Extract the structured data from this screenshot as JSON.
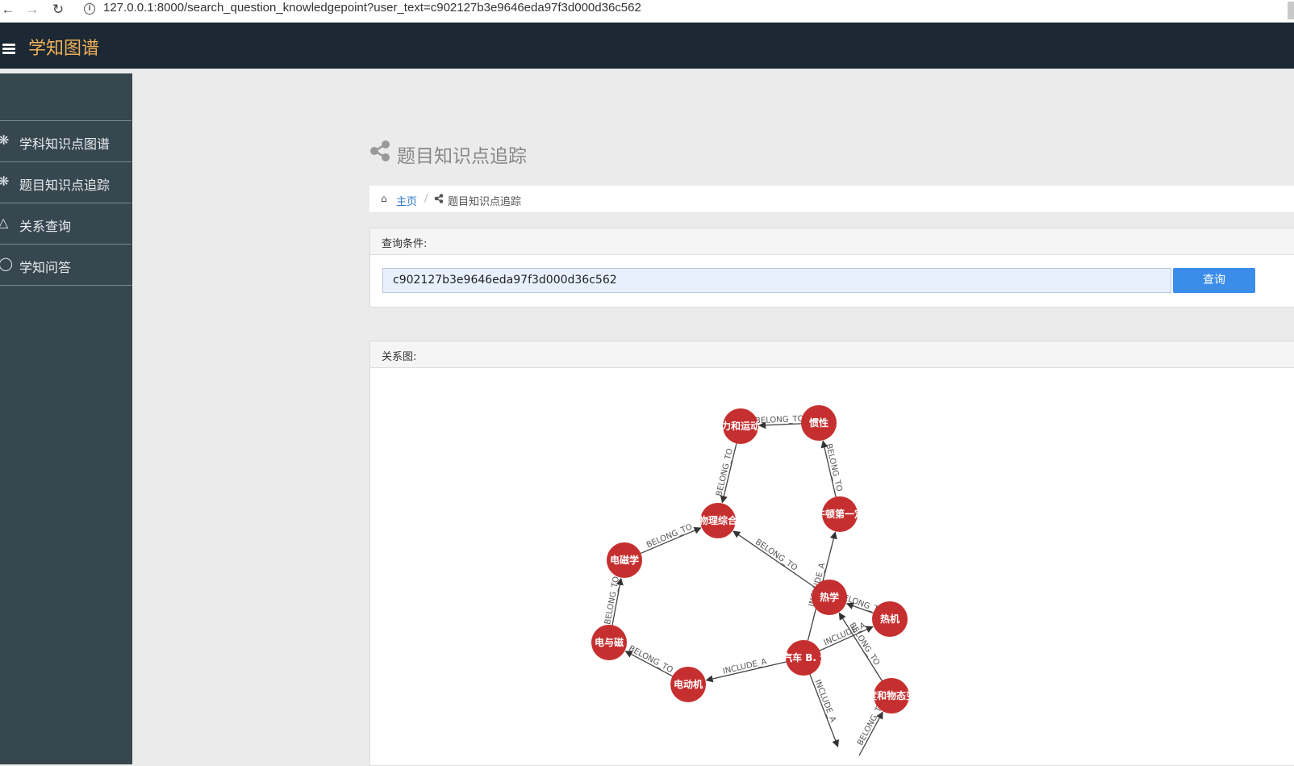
{
  "browser": {
    "url": "127.0.0.1:8000/search_question_knowledgepoint?user_text=c902127b3e9646eda97f3d000d36c562"
  },
  "app": {
    "brand": "学知图谱"
  },
  "sidebar": {
    "items": [
      {
        "label": "学科知识点图谱",
        "icon": "atom-icon"
      },
      {
        "label": "题目知识点追踪",
        "icon": "atom-icon"
      },
      {
        "label": "关系查询",
        "icon": "drive-icon"
      },
      {
        "label": "学知问答",
        "icon": "chat-icon"
      }
    ]
  },
  "page": {
    "title": "题目知识点追踪"
  },
  "breadcrumb": {
    "home": "主页",
    "separator": "/",
    "current": "题目知识点追踪"
  },
  "query": {
    "header": "查询条件:",
    "value": "c902127b3e9646eda97f3d000d36c562",
    "button": "查询"
  },
  "graph": {
    "header": "关系图:",
    "node_color": "#c62f2f",
    "nodes": [
      {
        "id": "n_force",
        "label": "力和运动"
      },
      {
        "id": "n_inertia",
        "label": "惯性"
      },
      {
        "id": "n_physics",
        "label": "物理综合"
      },
      {
        "id": "n_newton",
        "label": "牛顿第一定"
      },
      {
        "id": "n_em",
        "label": "电磁学"
      },
      {
        "id": "n_heat",
        "label": "热学"
      },
      {
        "id": "n_engine",
        "label": "热机"
      },
      {
        "id": "n_emag",
        "label": "电与磁"
      },
      {
        "id": "n_question",
        "label": "A. 汽车 B. 汽车"
      },
      {
        "id": "n_motor",
        "label": "电动机"
      },
      {
        "id": "n_state",
        "label": "温度和物态变化"
      }
    ],
    "edges": [
      {
        "from": "n_inertia",
        "to": "n_force",
        "label": "BELONG_TO"
      },
      {
        "from": "n_force",
        "to": "n_physics",
        "label": "BELONG_TO"
      },
      {
        "from": "n_newton",
        "to": "n_inertia",
        "label": "BELONG_TO"
      },
      {
        "from": "n_em",
        "to": "n_physics",
        "label": "BELONG_TO"
      },
      {
        "from": "n_heat",
        "to": "n_physics",
        "label": "BELONG_TO"
      },
      {
        "from": "n_question",
        "to": "n_newton",
        "label": "INCLUDE_A"
      },
      {
        "from": "n_engine",
        "to": "n_heat",
        "label": "BELONG_TO"
      },
      {
        "from": "n_emag",
        "to": "n_em",
        "label": "BELONG_TO"
      },
      {
        "from": "n_question",
        "to": "n_engine",
        "label": "INCLUDE_A"
      },
      {
        "from": "n_state",
        "to": "n_heat",
        "label": "BELONG_TO"
      },
      {
        "from": "n_motor",
        "to": "n_emag",
        "label": "BELONG_TO"
      },
      {
        "from": "n_question",
        "to": "n_motor",
        "label": "INCLUDE_A"
      },
      {
        "from": "n_question",
        "to": "n_state_off",
        "label": "INCLUDE_A"
      },
      {
        "from": "n_state_low",
        "to": "n_state",
        "label": "BELONG_TO"
      }
    ]
  }
}
